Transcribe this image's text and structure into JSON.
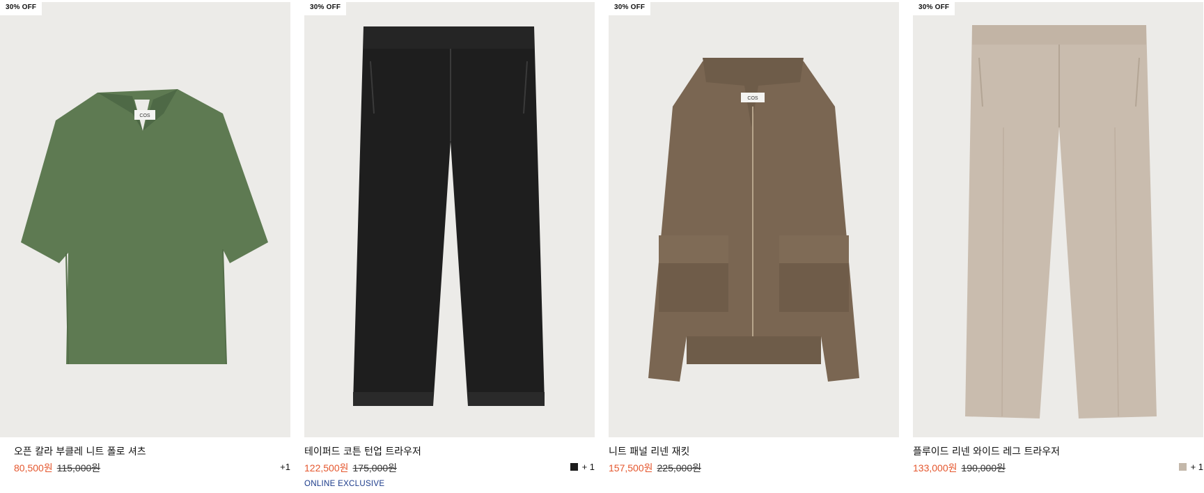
{
  "products": [
    {
      "badge": "30% OFF",
      "name": "오픈 칼라 부클레 니트 폴로 셔츠",
      "sale_price": "80,500원",
      "original_price": "115,000원",
      "more_colors": "+1",
      "swatch_color": "",
      "exclusive": "",
      "garment_color": "#5e7a52"
    },
    {
      "badge": "30% OFF",
      "name": "테이퍼드 코튼 턴업 트라우저",
      "sale_price": "122,500원",
      "original_price": "175,000원",
      "more_colors": "+ 1",
      "swatch_color": "#1c1c1c",
      "exclusive": "ONLINE EXCLUSIVE",
      "garment_color": "#1e1e1e"
    },
    {
      "badge": "30% OFF",
      "name": "니트 패널 리넨 재킷",
      "sale_price": "157,500원",
      "original_price": "225,000원",
      "more_colors": "",
      "swatch_color": "",
      "exclusive": "",
      "garment_color": "#7a6652"
    },
    {
      "badge": "30% OFF",
      "name": "플루이드 리넨 와이드 레그 트라우저",
      "sale_price": "133,000원",
      "original_price": "190,000원",
      "more_colors": "+ 1",
      "swatch_color": "#c4b8aa",
      "exclusive": "",
      "garment_color": "#c9bcae"
    }
  ],
  "label_text": "COS"
}
